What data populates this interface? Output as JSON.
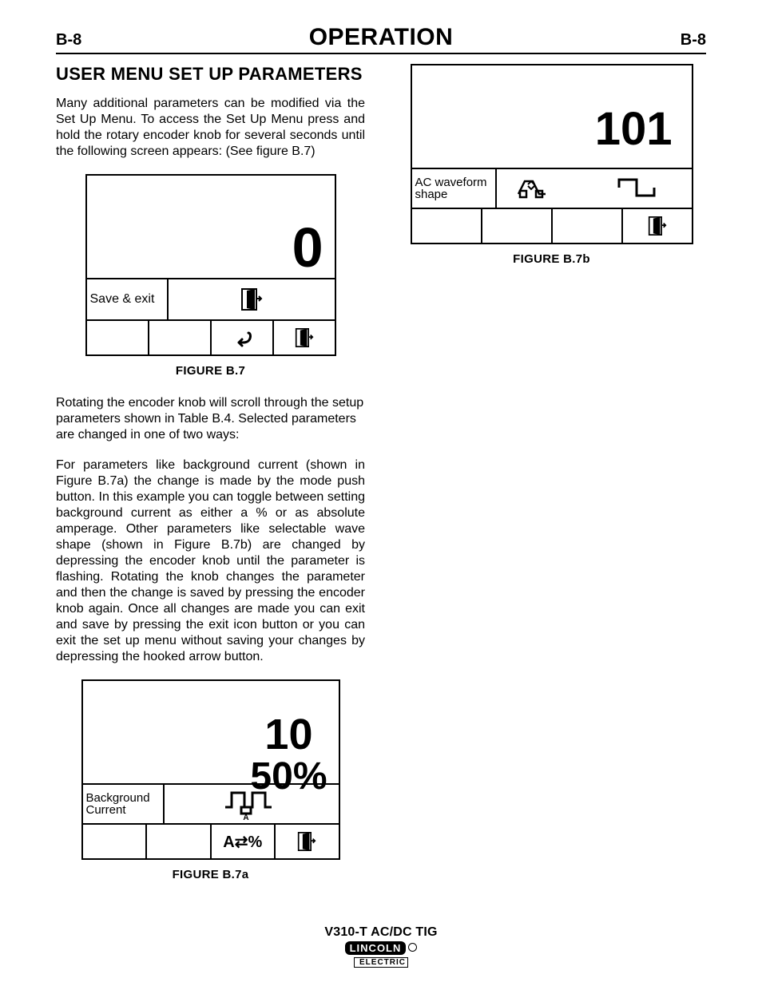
{
  "header": {
    "page_left": "B-8",
    "title": "OPERATION",
    "page_right": "B-8"
  },
  "section_title": "USER MENU SET UP PARAMETERS",
  "para1": "Many additional parameters can be modified via the Set Up Menu. To access the Set Up Menu press and hold the rotary encoder knob for several seconds until the following screen appears: (See figure B.7)",
  "figB7": {
    "big_value": "0",
    "row_label": "Save & exit",
    "caption": "FIGURE B.7"
  },
  "para2": "Rotating the encoder knob will scroll through the setup parameters shown in Table B.4.  Selected parameters are changed in one of two ways:",
  "para3": "For parameters like background current (shown in Figure B.7a) the change is made by the mode push button.  In this example you can toggle between setting background current as either a % or as absolute amperage.  Other parameters like selectable wave shape (shown in Figure B.7b) are changed by depressing the encoder knob until the parameter is flashing.  Rotating the knob changes the parameter and then the change is saved by pressing the encoder knob again.  Once all changes are made you can exit and save by pressing the exit icon button or you can exit the set up menu without saving your changes by depressing the hooked arrow button.",
  "figB7a": {
    "val_top": "10",
    "val_bottom": "50%",
    "row_label_1": "Background",
    "row_label_2": "Current",
    "soft_label": "A⇄%",
    "caption": "FIGURE B.7a"
  },
  "figB7b": {
    "val": "101",
    "row_label_1": "AC waveform",
    "row_label_2": "shape",
    "caption": "FIGURE B.7b"
  },
  "footer": {
    "product": "V310-T AC/DC TIG",
    "brand_top": "LINCOLN",
    "brand_bottom": "ELECTRIC"
  }
}
